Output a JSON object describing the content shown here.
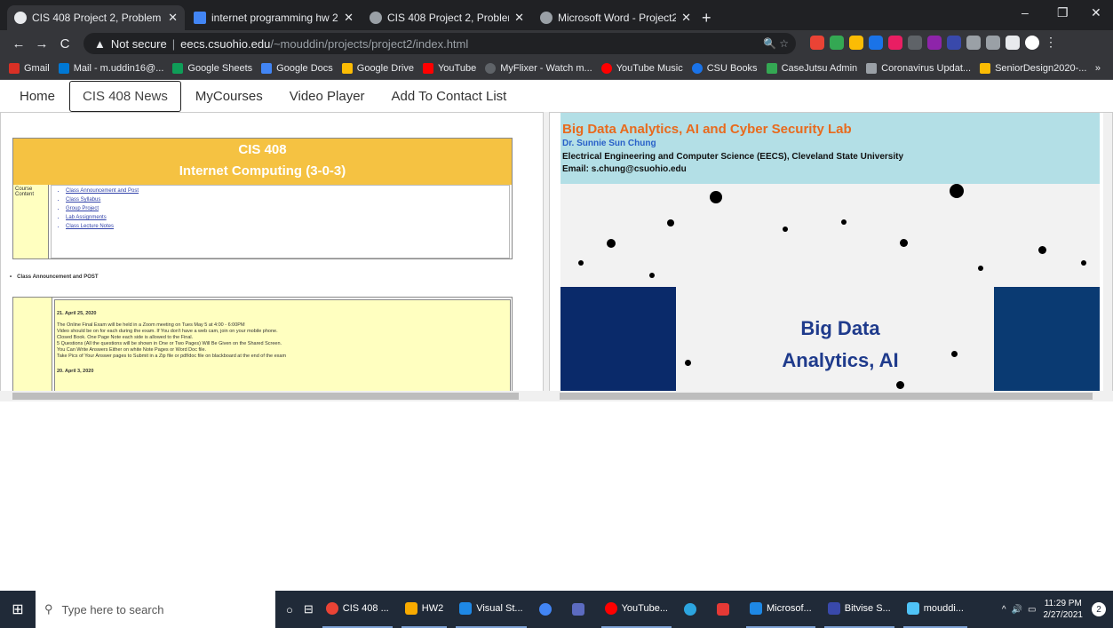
{
  "browser": {
    "tabs": [
      {
        "title": "CIS 408 Project 2, Problem 1",
        "active": true,
        "favicon_color": "#e8eaed"
      },
      {
        "title": "internet programming hw 2 - Go",
        "active": false,
        "favicon_color": "#4285f4"
      },
      {
        "title": "CIS 408 Project 2, Problem 1",
        "active": false,
        "favicon_color": "#9aa0a6"
      },
      {
        "title": "Microsoft Word - Project2_CIS40",
        "active": false,
        "favicon_color": "#9aa0a6"
      }
    ],
    "new_tab": "+",
    "window_controls": {
      "minimize": "–",
      "maximize": "❐",
      "close": "✕"
    },
    "toolbar": {
      "back": "←",
      "forward": "→",
      "reload": "C",
      "security_label": "Not secure",
      "url_domain": "eecs.csuohio.edu",
      "url_path": "/~mouddin/projects/project2/index.html"
    },
    "bookmarks": [
      {
        "label": "Gmail",
        "color": "#d93025"
      },
      {
        "label": "Mail - m.uddin16@...",
        "color": "#0078d4"
      },
      {
        "label": "Google Sheets",
        "color": "#0f9d58"
      },
      {
        "label": "Google Docs",
        "color": "#4285f4"
      },
      {
        "label": "Google Drive",
        "color": "#fbbc04"
      },
      {
        "label": "YouTube",
        "color": "#ff0000"
      },
      {
        "label": "MyFlixer - Watch m...",
        "color": "#5f6368"
      },
      {
        "label": "YouTube Music",
        "color": "#ff0000"
      },
      {
        "label": "CSU Books",
        "color": "#1a73e8"
      },
      {
        "label": "CaseJutsu Admin",
        "color": "#34a853"
      },
      {
        "label": "Coronavirus Updat...",
        "color": "#9aa0a6"
      },
      {
        "label": "SeniorDesign2020-...",
        "color": "#fbbc04"
      }
    ],
    "bookmarks_overflow": "»"
  },
  "site": {
    "nav": [
      "Home",
      "CIS 408 News",
      "MyCourses",
      "Video Player",
      "Add To Contact List"
    ],
    "left_frame": {
      "course_title": "CIS 408",
      "course_subtitle": "Internet Computing (3-0-3)",
      "label": "Course Content",
      "links": [
        "Class Announcement and Post",
        "Class Syllabus",
        "Group Project",
        "Lab Assignments",
        "Class Lecture Notes"
      ],
      "announcement_heading": "Class Announcement and POST",
      "announcement_date": "21. April 25, 2020",
      "announcement_lines": [
        "The Online Final Exam will be held in a Zoom meeting on Tues May 5 at 4:00 - 6:00PM",
        "Video should be on for each during the exam. If You don't have a web cam, join on your mobile phone.",
        "Closed Book. One Page Note each side is allowed to the Final.",
        "5 Questions (All the questions will be shown in One or Two Pages) Will Be Given on the Shared Screen.",
        "You Can Write Answers Either on white Note Pages or Word Doc file.",
        "Take Pics of Your Answer pages to Submit in a Zip file or pdf/doc file on blackboard at the end of the exam"
      ],
      "next_date": "20. April 3, 2020"
    },
    "right_frame": {
      "title": "Big Data Analytics, AI and Cyber Security Lab",
      "person": "Dr. Sunnie Sun Chung",
      "department": "Electrical Engineering and Computer Science (EECS), Cleveland State University",
      "email": "Email: s.chung@csuohio.edu",
      "art_line1": "Big Data",
      "art_line2": "Analytics, AI"
    }
  },
  "taskbar": {
    "search_placeholder": "Type here to search",
    "apps": [
      {
        "label": "CIS 408 ...",
        "color": "#ea4335"
      },
      {
        "label": "HW2",
        "color": "#f9ab00"
      },
      {
        "label": "Visual St...",
        "color": "#1e88e5"
      },
      {
        "label": "",
        "color": "#4285f4"
      },
      {
        "label": "",
        "color": "#5c6bc0"
      },
      {
        "label": "YouTube...",
        "color": "#ff0000"
      },
      {
        "label": "",
        "color": "#2ca5e0"
      },
      {
        "label": "",
        "color": "#e53935"
      },
      {
        "label": "Microsof...",
        "color": "#1e88e5"
      },
      {
        "label": "Bitvise S...",
        "color": "#3949ab"
      },
      {
        "label": "mouddi...",
        "color": "#4fc3f7"
      }
    ],
    "time": "11:29 PM",
    "date": "2/27/2021",
    "notification_count": "2"
  }
}
